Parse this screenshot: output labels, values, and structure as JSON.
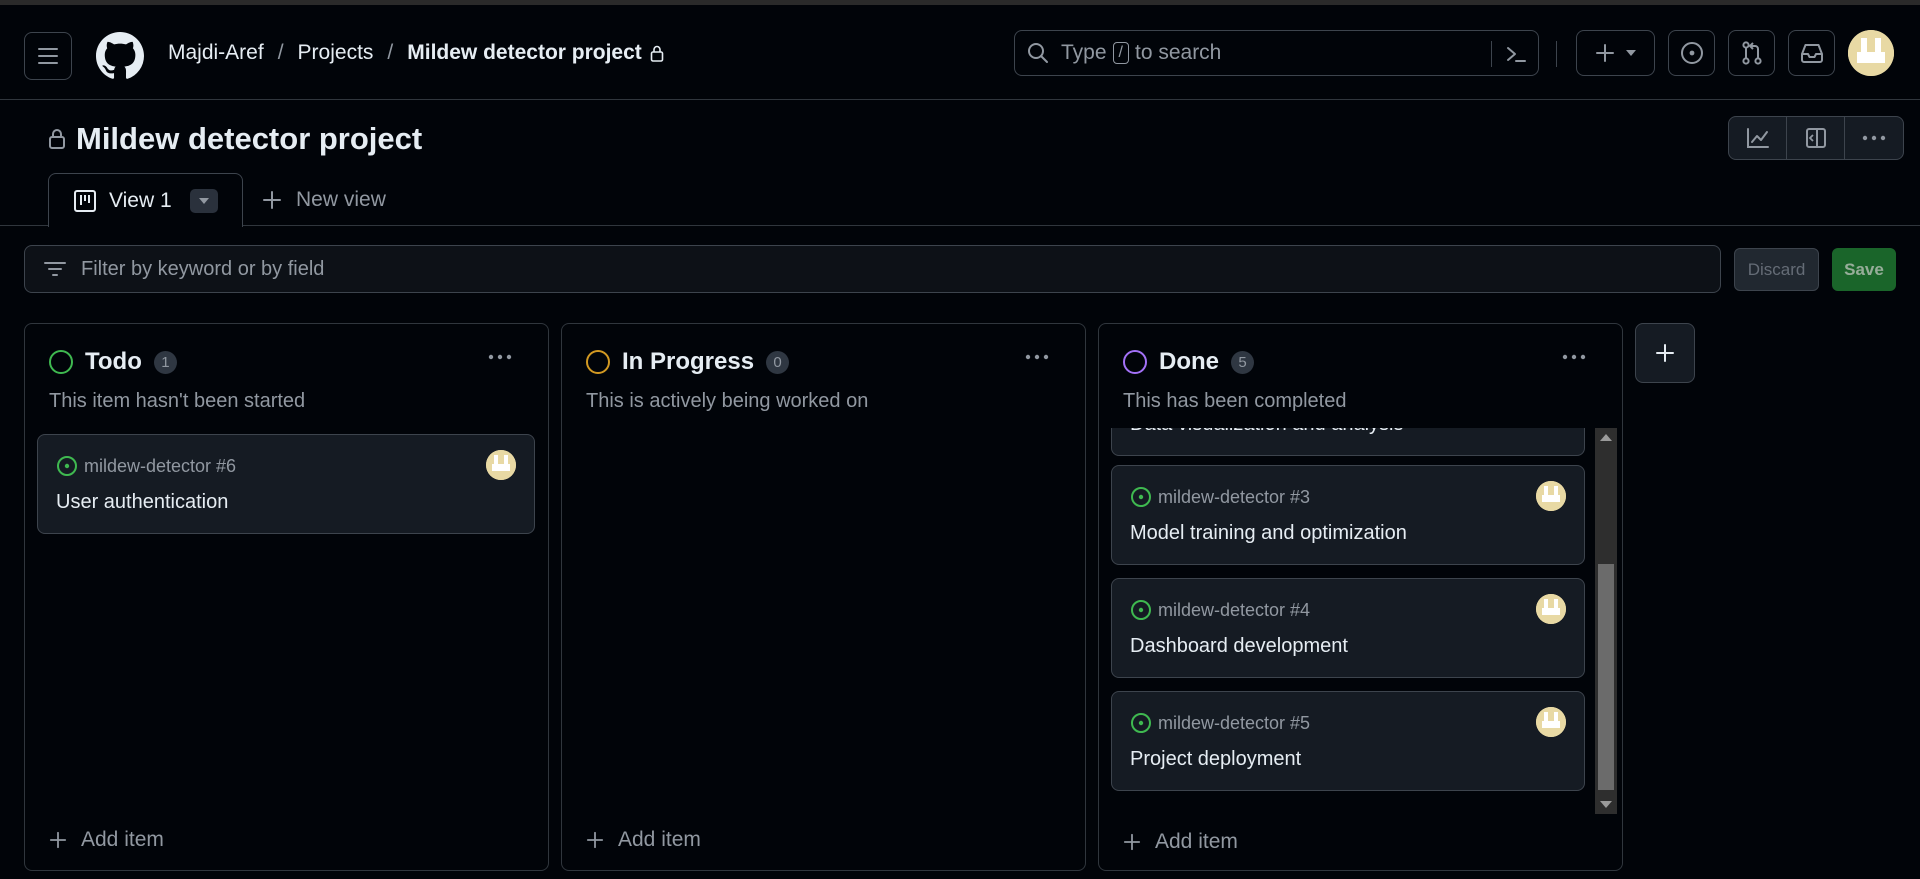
{
  "header": {
    "breadcrumbs": [
      "Majdi-Aref",
      "Projects",
      "Mildew detector project"
    ],
    "search": {
      "prefix": "Type",
      "key": "/",
      "suffix": "to search"
    }
  },
  "project": {
    "title": "Mildew detector project",
    "tabs": [
      {
        "label": "View 1",
        "active": true
      },
      {
        "label": "New view",
        "active": false
      }
    ]
  },
  "filter": {
    "placeholder": "Filter by keyword or by field",
    "discard_label": "Discard",
    "save_label": "Save"
  },
  "columns": [
    {
      "name": "Todo",
      "count": "1",
      "color": "#3fb950",
      "description": "This item hasn't been started",
      "add_label": "Add item",
      "cards": [
        {
          "ref": "mildew-detector #6",
          "title": "User authentication"
        }
      ]
    },
    {
      "name": "In Progress",
      "count": "0",
      "color": "#d29922",
      "description": "This is actively being worked on",
      "add_label": "Add item",
      "cards": []
    },
    {
      "name": "Done",
      "count": "5",
      "color": "#a371f7",
      "description": "This has been completed",
      "add_label": "Add item",
      "cards": [
        {
          "ref": "",
          "title": "Data visualization and analysis"
        },
        {
          "ref": "mildew-detector #3",
          "title": "Model training and optimization"
        },
        {
          "ref": "mildew-detector #4",
          "title": "Dashboard development"
        },
        {
          "ref": "mildew-detector #5",
          "title": "Project deployment"
        }
      ]
    }
  ],
  "icons": {
    "menu": "hamburger-icon",
    "logo": "github-logo",
    "lock": "lock-icon",
    "search": "search-icon",
    "command": "command-palette-icon",
    "plus": "plus-icon",
    "issues": "issue-opened-icon",
    "pulls": "git-pull-request-icon",
    "inbox": "inbox-icon",
    "insights": "graph-icon",
    "panel": "sidebar-icon",
    "more": "kebab-horizontal-icon",
    "board": "project-board-icon",
    "filter": "filter-icon"
  }
}
